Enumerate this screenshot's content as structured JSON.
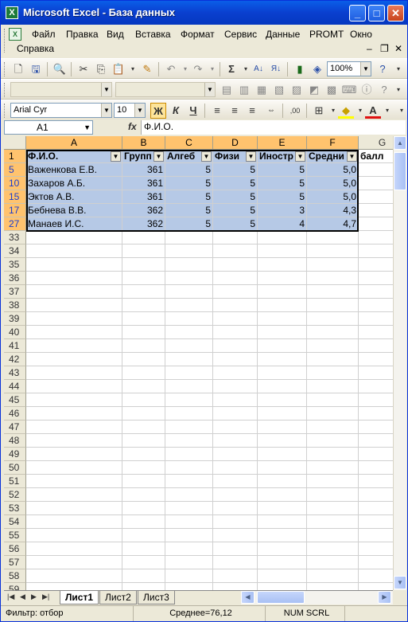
{
  "window": {
    "title": "Microsoft Excel - База данных",
    "app_icon": "X"
  },
  "menu": [
    "Файл",
    "Правка",
    "Вид",
    "Вставка",
    "Формат",
    "Сервис",
    "Данные",
    "PROMT",
    "Окно",
    "Справка"
  ],
  "toolbar": {
    "zoom": "100%"
  },
  "format": {
    "font": "Arial Cyr",
    "size": "10",
    "bold": "Ж",
    "italic": "К",
    "underline": "Ч"
  },
  "formula": {
    "namebox": "A1",
    "fx": "fx",
    "content": "Ф.И.О."
  },
  "columns": [
    "A",
    "B",
    "C",
    "D",
    "E",
    "F",
    "G"
  ],
  "header_row": {
    "row": "1",
    "cells": [
      "Ф.И.О.",
      "Группа",
      "Алгебра",
      "Физика",
      "Иностр",
      "Средний балл"
    ],
    "cells_shown": [
      "Ф.И.О.",
      "Групп",
      "Алгеб",
      "Физи",
      "Иностр",
      "Средни"
    ],
    "g_overflow": "балл"
  },
  "data_rows": [
    {
      "row": "5",
      "cells": [
        "Важенкова Е.В.",
        "361",
        "5",
        "5",
        "5",
        "5,0"
      ]
    },
    {
      "row": "10",
      "cells": [
        "Захаров А.Б.",
        "361",
        "5",
        "5",
        "5",
        "5,0"
      ]
    },
    {
      "row": "15",
      "cells": [
        "Эктов А.В.",
        "361",
        "5",
        "5",
        "5",
        "5,0"
      ]
    },
    {
      "row": "17",
      "cells": [
        "Бебнева В.В.",
        "362",
        "5",
        "5",
        "3",
        "4,3"
      ]
    },
    {
      "row": "27",
      "cells": [
        "Манаев И.С.",
        "362",
        "5",
        "5",
        "4",
        "4,7"
      ]
    }
  ],
  "empty_rows": [
    "33",
    "34",
    "35",
    "36",
    "37",
    "38",
    "39",
    "40",
    "41",
    "42",
    "43",
    "44",
    "45",
    "46",
    "47",
    "48",
    "49",
    "50",
    "51",
    "52",
    "53",
    "54",
    "55",
    "56",
    "57",
    "58",
    "59"
  ],
  "sheets": [
    "Лист1",
    "Лист2",
    "Лист3"
  ],
  "status": {
    "left": "Фильтр: отбор",
    "sum": "Среднее=76,12",
    "mode": "NUM SCRL"
  }
}
